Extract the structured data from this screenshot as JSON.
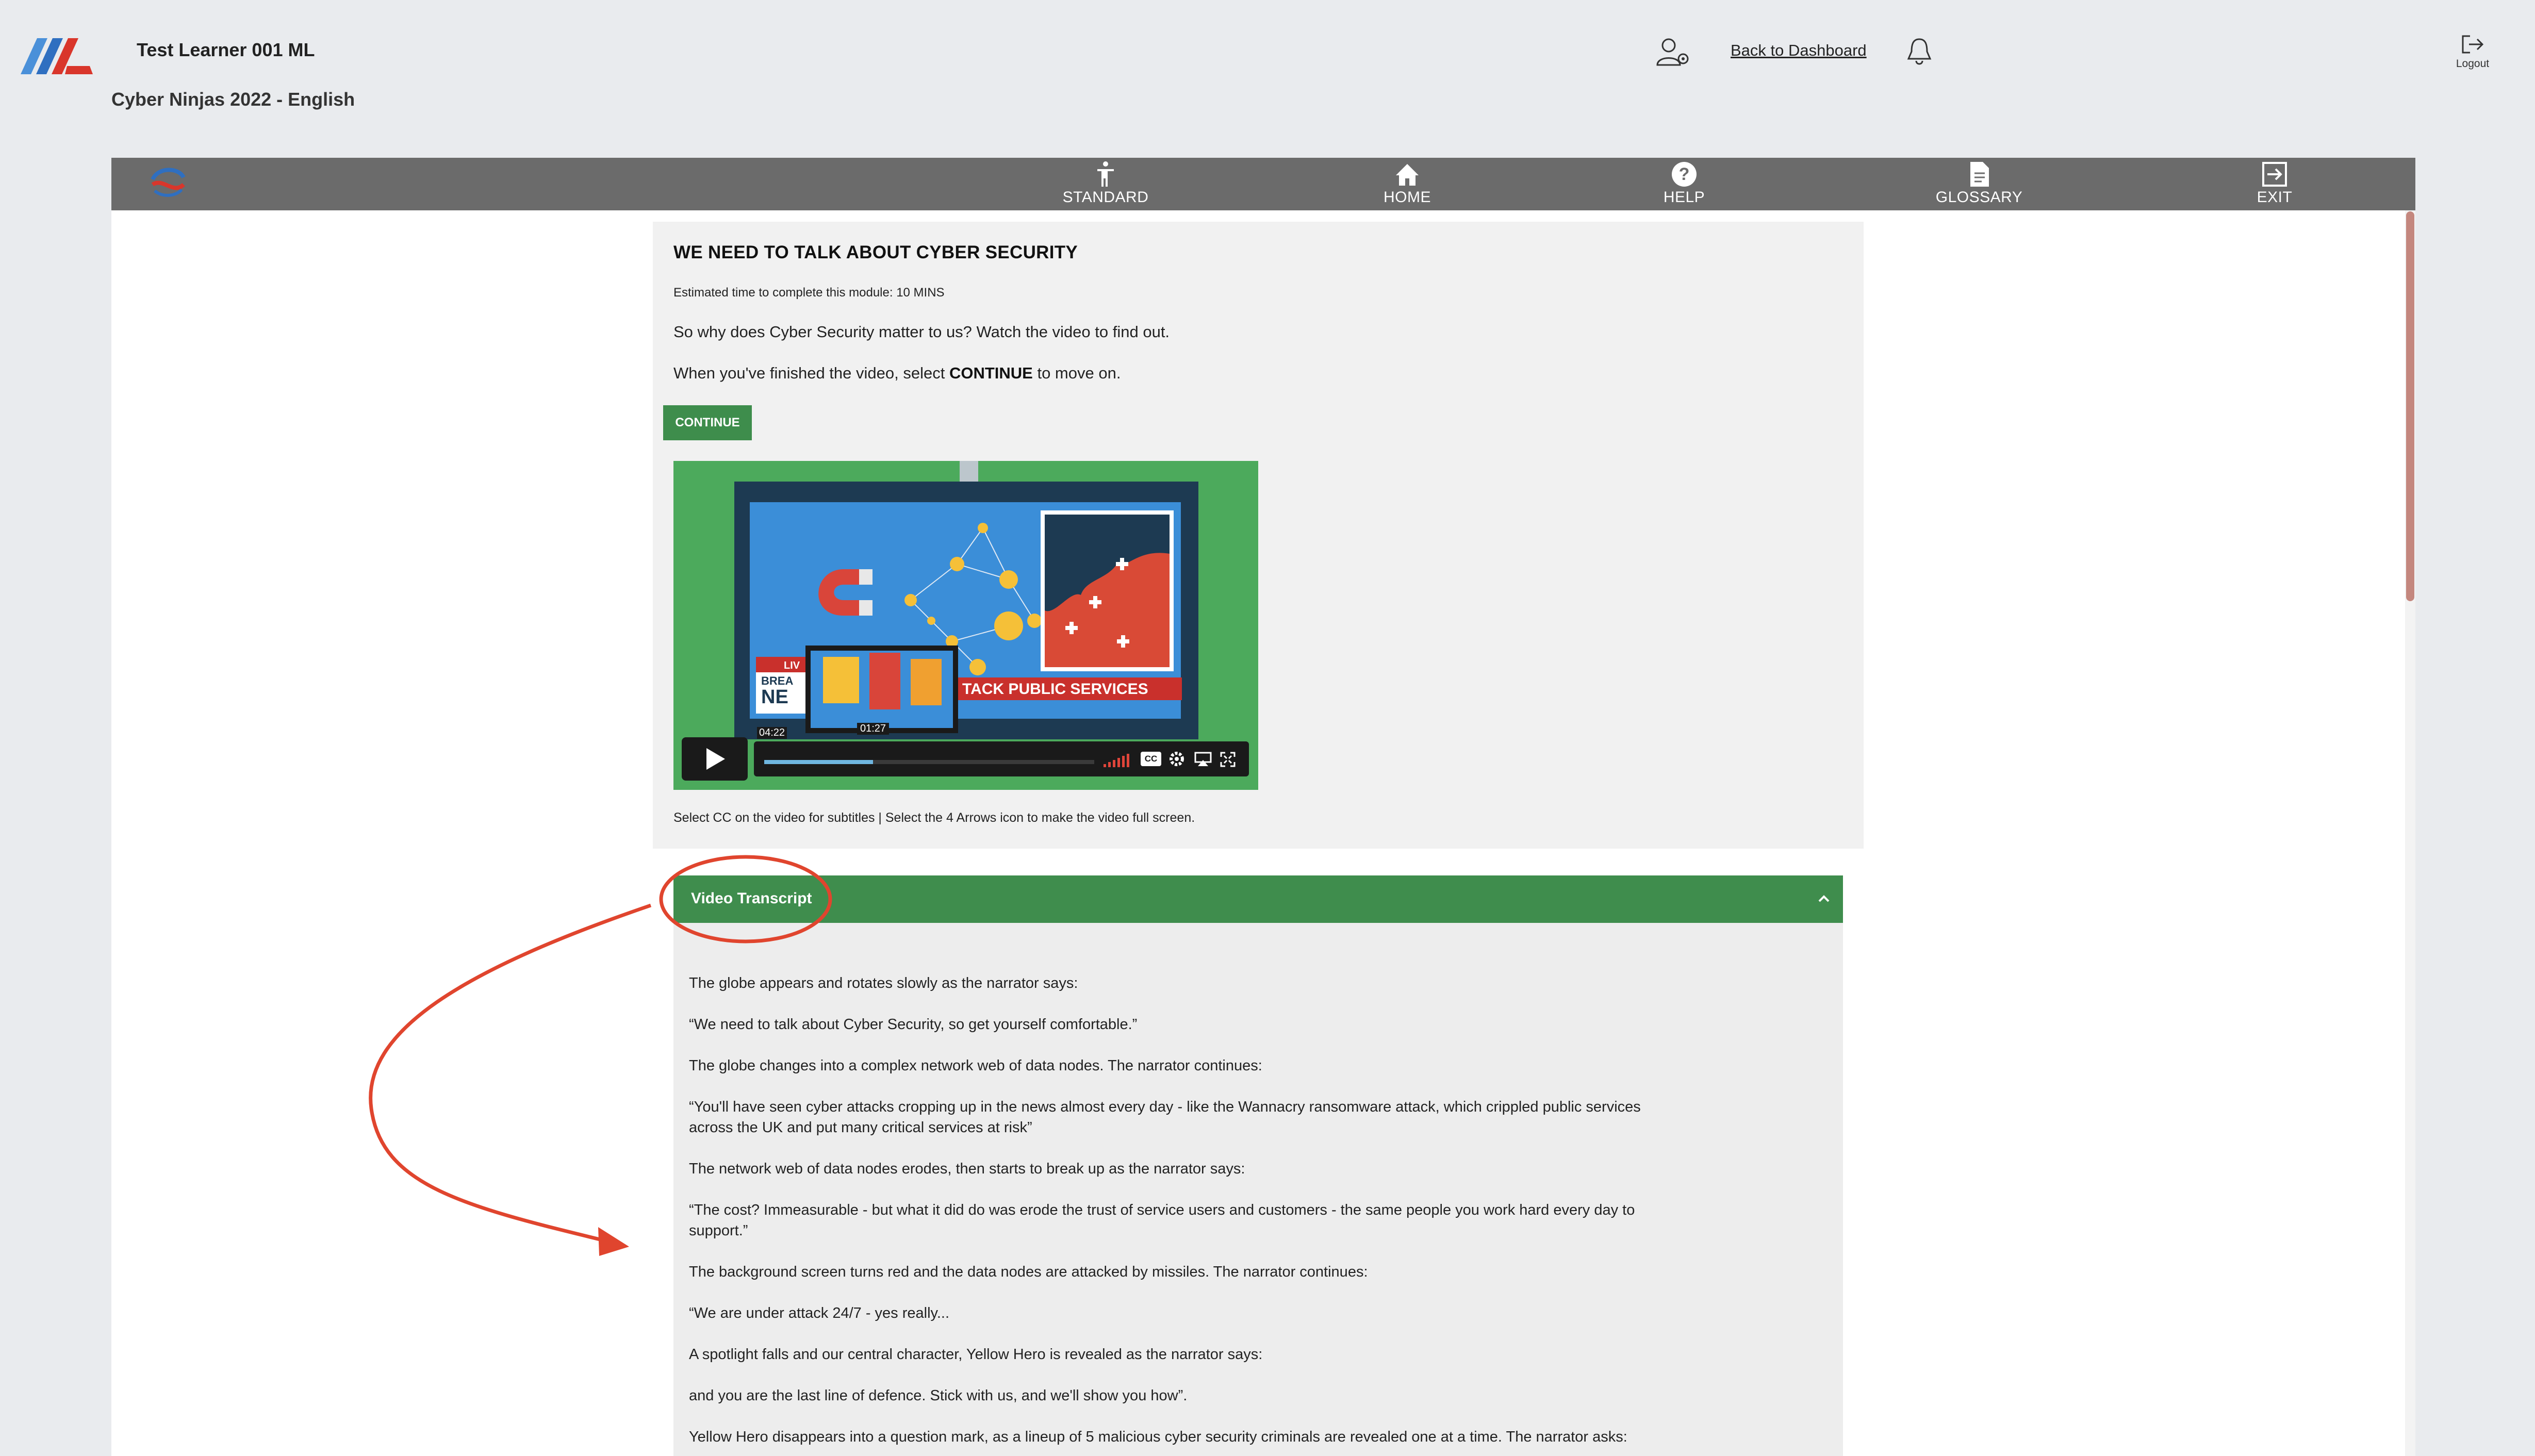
{
  "header": {
    "learner_name": "Test Learner 001 ML",
    "course_title": "Cyber Ninjas 2022 - English",
    "back_to_dashboard": "Back to Dashboard",
    "logout_label": "Logout",
    "icons": [
      "logo-icon",
      "user-settings-icon",
      "bell-icon",
      "logout-icon"
    ]
  },
  "navbar": {
    "items": [
      {
        "label": "STANDARD",
        "icon": "accessibility-icon"
      },
      {
        "label": "HOME",
        "icon": "home-icon"
      },
      {
        "label": "HELP",
        "icon": "help-icon"
      },
      {
        "label": "GLOSSARY",
        "icon": "glossary-icon"
      },
      {
        "label": "EXIT",
        "icon": "exit-icon"
      }
    ]
  },
  "module": {
    "title": "WE NEED TO TALK ABOUT CYBER SECURITY",
    "estimated_time": "Estimated time to complete this module: 10 MINS",
    "intro": "So why does Cyber Security matter to us? Watch the video to find out.",
    "instruction_prefix": "When you've finished the video, select ",
    "instruction_bold": "CONTINUE",
    "instruction_suffix": " to move on.",
    "continue_label": "CONTINUE",
    "video_caption": "Select CC on the video for subtitles | Select the 4 Arrows icon to make the video full screen."
  },
  "video": {
    "banner_live": "LIV",
    "banner_breaking": "BREA",
    "banner_news": "NE",
    "headline": "TACK PUBLIC SERVICES",
    "duration": "04:22",
    "current_time": "01:27",
    "cc_label": "CC",
    "progress_fraction": 0.33
  },
  "transcript": {
    "title": "Video Transcript",
    "lines": [
      "The globe appears and rotates slowly as the narrator says:",
      "“We need to talk about Cyber Security, so get yourself comfortable.”",
      " The globe changes into a complex network web of data nodes. The narrator continues:",
      " “You'll have seen cyber attacks cropping up in the news almost every day - like the Wannacry ransomware attack, which crippled public services",
      "across the UK and put many critical services at risk”",
      " The network web of data nodes erodes, then starts to break up as the narrator says:",
      " “The cost? Immeasurable - but what it did do was erode the trust of service users and customers - the same people you work hard every day to",
      "support.”",
      "The background screen turns red and the data nodes are attacked by missiles. The narrator continues:",
      " “We are under attack 24/7 - yes really...",
      " A spotlight falls and our central character, Yellow Hero is revealed as the narrator says:",
      " and you are the last line of defence. Stick with us, and we'll show you how”.",
      " Yellow Hero disappears into a question mark, as a lineup of 5 malicious cyber security criminals are revealed one at a time. The narrator asks:"
    ]
  },
  "colors": {
    "navbar": "#6b6b6b",
    "accent_green": "#3f8d4d",
    "annotation_red": "#e0452e"
  }
}
